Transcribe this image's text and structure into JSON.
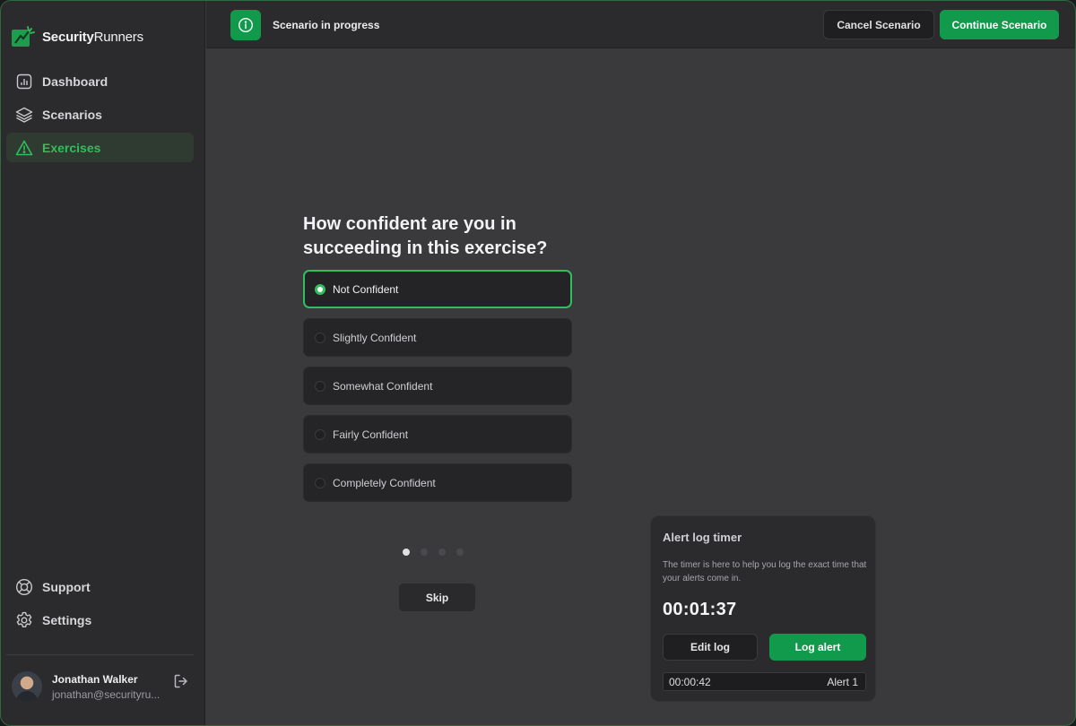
{
  "brand": {
    "name_bold": "Security",
    "name_regular": "Runners"
  },
  "sidebar": {
    "items": [
      {
        "label": "Dashboard",
        "icon": "bar-chart-icon"
      },
      {
        "label": "Scenarios",
        "icon": "layers-icon"
      },
      {
        "label": "Exercises",
        "icon": "warning-triangle-icon",
        "active": true
      }
    ],
    "bottom_items": [
      {
        "label": "Support",
        "icon": "lifebuoy-icon"
      },
      {
        "label": "Settings",
        "icon": "gear-icon"
      }
    ]
  },
  "user": {
    "name": "Jonathan Walker",
    "email": "jonathan@securityru..."
  },
  "topbar": {
    "status": "Scenario in progress",
    "cancel_label": "Cancel Scenario",
    "continue_label": "Continue Scenario"
  },
  "question": {
    "text": "How confident are you in succeeding in this exercise?",
    "options": [
      {
        "label": "Not Confident",
        "selected": true
      },
      {
        "label": "Slightly Confident",
        "selected": false
      },
      {
        "label": "Somewhat Confident",
        "selected": false
      },
      {
        "label": "Fairly Confident",
        "selected": false
      },
      {
        "label": "Completely Confident",
        "selected": false
      }
    ],
    "pagination": {
      "current": 1,
      "total": 4
    },
    "skip_label": "Skip"
  },
  "timer": {
    "title": "Alert log timer",
    "description": "The timer is here to help you log the exact time that your alerts come in.",
    "value": "00:01:37",
    "edit_label": "Edit log",
    "log_label": "Log alert",
    "entries": [
      {
        "time": "00:00:42",
        "label": "Alert 1"
      }
    ]
  },
  "colors": {
    "accent": "#119a4b",
    "accent_bright": "#2fbf5c",
    "background": "#3a3a3d",
    "panel": "#2b2b2e"
  }
}
